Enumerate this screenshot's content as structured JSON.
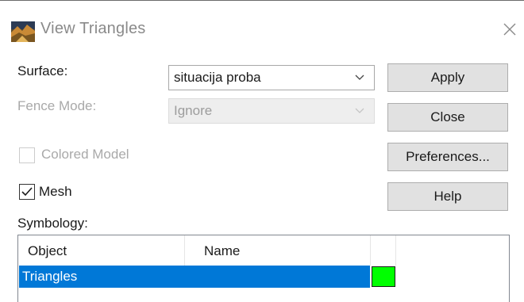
{
  "window": {
    "title": "View Triangles",
    "icon": "landscape-app-icon",
    "close_icon": "close-icon"
  },
  "surface": {
    "label": "Surface:",
    "value": "situacija proba"
  },
  "fence_mode": {
    "label": "Fence Mode:",
    "value": "Ignore",
    "disabled": true
  },
  "options": {
    "colored_model": {
      "label": "Colored Model",
      "checked": false,
      "disabled": true
    },
    "mesh": {
      "label": "Mesh",
      "checked": true
    }
  },
  "buttons": {
    "apply": "Apply",
    "close": "Close",
    "preferences": "Preferences...",
    "help": "Help"
  },
  "symbology": {
    "label": "Symbology:",
    "columns": [
      "Object",
      "Name"
    ],
    "rows": [
      {
        "object": "Triangles",
        "name": "",
        "color": "#00ff00",
        "selected": true
      }
    ]
  },
  "colors": {
    "selection": "#0078d7",
    "swatch": "#00ff00",
    "button_face": "#e1e1e1"
  }
}
